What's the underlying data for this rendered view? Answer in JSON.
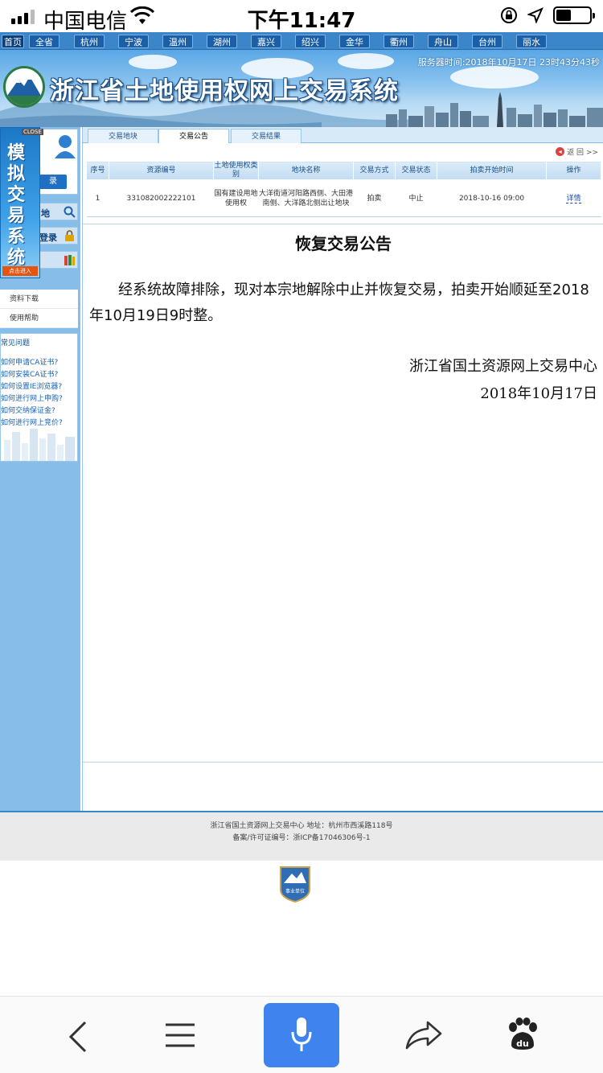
{
  "status_bar": {
    "carrier": "中国电信",
    "time": "下午11:47"
  },
  "city_nav": {
    "items": [
      "首页",
      "全省",
      "杭州",
      "宁波",
      "温州",
      "湖州",
      "嘉兴",
      "绍兴",
      "金华",
      "衢州",
      "舟山",
      "台州",
      "丽水"
    ]
  },
  "header": {
    "site_title": "浙江省土地使用权网上交易系统",
    "server_time": "服务器时间:2018年10月17日 23时43分43秒"
  },
  "float_ad": {
    "close_label": "CLOSE",
    "title": "模拟交易系统",
    "button": "点击进入"
  },
  "sidebar": {
    "login_label": "录",
    "search_label": "地",
    "register_label": "登录",
    "download": "资料下载",
    "help": "使用帮助",
    "faq_title": "常见问题",
    "faq": [
      "如何申请CA证书?",
      "如何安装CA证书?",
      "如何设置IE浏览器?",
      "如何进行网上申购?",
      "如何交纳保证金?",
      "如何进行网上竞价?"
    ]
  },
  "tabs": [
    {
      "label": "交易地块"
    },
    {
      "label": "交易公告"
    },
    {
      "label": "交易结果"
    }
  ],
  "back_label": "返 回 >>",
  "table": {
    "headers": [
      "序号",
      "资源编号",
      "土地使用权类别",
      "地块名称",
      "交易方式",
      "交易状态",
      "拍卖开始时间",
      "操作"
    ],
    "rows": [
      {
        "index": "1",
        "code": "331082002222101",
        "category": "国有建设用地使用权",
        "name": "大洋街道河阳路西侧、大田港南侧、大洋路北侧出让地块",
        "method": "拍卖",
        "status": "中止",
        "start": "2018-10-16 09:00",
        "action": "详情"
      }
    ]
  },
  "notice": {
    "title": "恢复交易公告",
    "body": "经系统故障排除，现对本宗地解除中止并恢复交易，拍卖开始顺延至2018年10月19日9时整。",
    "signature": "浙江省国土资源网上交易中心",
    "date": "2018年10月17日"
  },
  "footer": {
    "line1": "浙江省国土资源网上交易中心 地址：杭州市西溪路118号",
    "line2": "备案/许可证编号：浙ICP备17046306号-1",
    "badge": "事业单位"
  },
  "browser_bar": {
    "icons": [
      "back-icon",
      "menu-icon",
      "microphone-icon",
      "share-icon",
      "baidu-icon"
    ]
  }
}
